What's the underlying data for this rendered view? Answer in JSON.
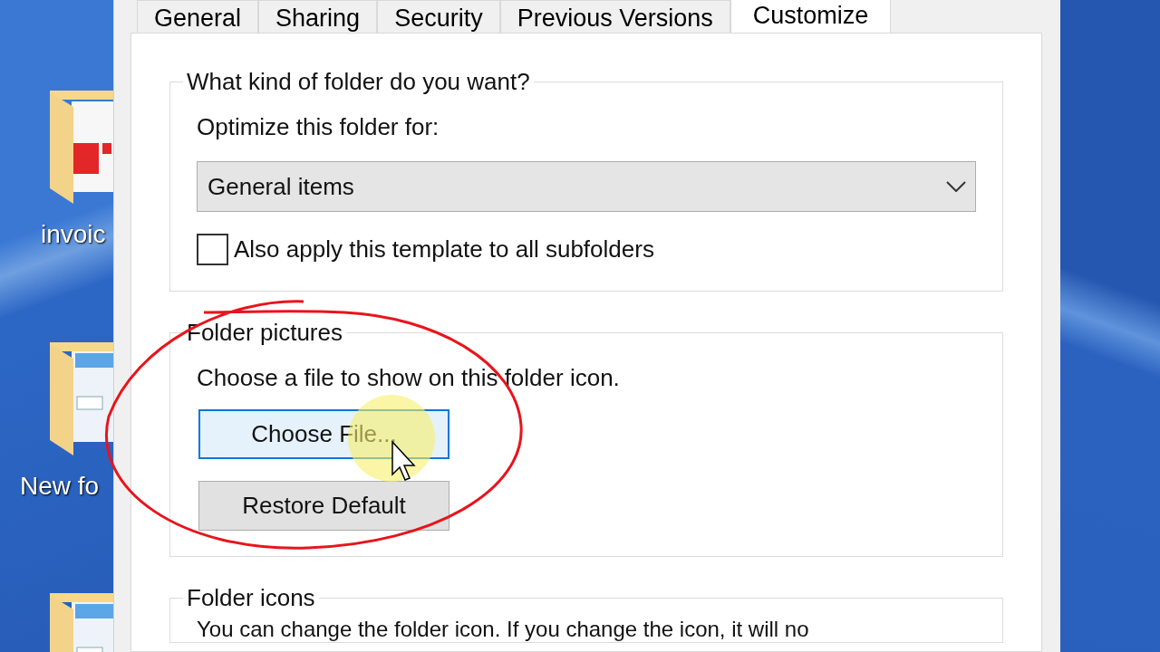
{
  "desktop": {
    "icons": [
      {
        "kind": "pdf",
        "label": "invoic"
      },
      {
        "kind": "window",
        "label": "New fo"
      },
      {
        "kind": "window"
      }
    ]
  },
  "dialog": {
    "tabs": [
      {
        "label": "General",
        "selected": false
      },
      {
        "label": "Sharing",
        "selected": false
      },
      {
        "label": "Security",
        "selected": false
      },
      {
        "label": "Previous Versions",
        "selected": false
      },
      {
        "label": "Customize",
        "selected": true
      }
    ],
    "folder_type": {
      "title": "What kind of folder do you want?",
      "optimize_label": "Optimize this folder for:",
      "dropdown": {
        "value": "General items"
      },
      "subfolders_checkbox": {
        "label": "Also apply this template to all subfolders",
        "checked": false
      }
    },
    "folder_pictures": {
      "title": "Folder pictures",
      "description": "Choose a file to show on this folder icon.",
      "buttons": [
        {
          "label": "Choose File...",
          "focused": true
        },
        {
          "label": "Restore Default",
          "focused": false
        }
      ]
    },
    "folder_icons": {
      "title": "Folder icons",
      "description": "You can change the folder icon. If you change the icon, it will no"
    }
  }
}
